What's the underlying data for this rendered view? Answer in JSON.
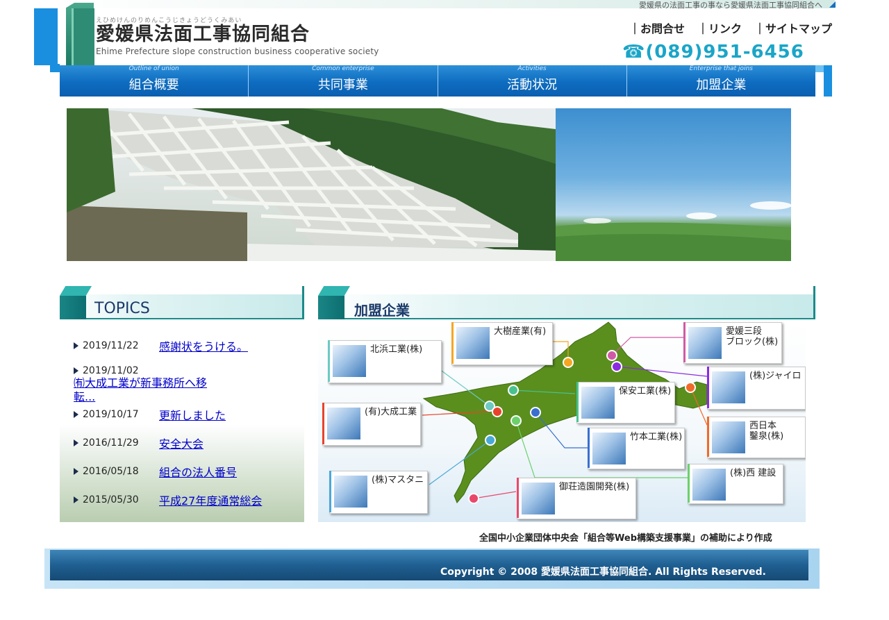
{
  "header": {
    "tagline": "愛媛県の法面工事の事なら愛媛県法面工事協同組合へ",
    "logo_ruby": "えひめけんのりめんこうじきょうどうくみあい",
    "logo_main": "愛媛県法面工事協同組合",
    "logo_en": "Ehime Prefecture slope construction business cooperative society",
    "links": [
      "｜お問合せ",
      "｜リンク",
      "｜サイトマップ"
    ],
    "phone": "☎(089)951-6456"
  },
  "nav": [
    {
      "en": "Outline of union",
      "jp": "組合概要"
    },
    {
      "en": "Common enterprise",
      "jp": "共同事業"
    },
    {
      "en": "Activities",
      "jp": "活動状況"
    },
    {
      "en": "Enterprise that joins",
      "jp": "加盟企業"
    }
  ],
  "topics": {
    "title": "TOPICS",
    "items": [
      {
        "date": "2019/11/22",
        "text": "感謝状をうける。"
      },
      {
        "date": "2019/11/02",
        "text": "㈲大成工業が新事務所へ移転..."
      },
      {
        "date": "2019/10/17",
        "text": "更新しました"
      },
      {
        "date": "2016/11/29",
        "text": "安全大会"
      },
      {
        "date": "2016/05/18",
        "text": "組合の法人番号"
      },
      {
        "date": "2015/05/30",
        "text": "平成27年度通常総会"
      }
    ]
  },
  "members": {
    "title": "加盟企業",
    "companies": [
      {
        "name": "北浜工業(株)",
        "color": "#6cc9c4"
      },
      {
        "name": "大樹産業(有)",
        "color": "#f5a623"
      },
      {
        "name": "愛媛三段\nブロック(株)",
        "color": "#d05aa5"
      },
      {
        "name": "(株)ジャイロ",
        "color": "#8a2be2"
      },
      {
        "name": "保安工業(株)",
        "color": "#4ac28f"
      },
      {
        "name": "(有)大成工業",
        "color": "#e8432a"
      },
      {
        "name": "西日本\n鑿泉(株)",
        "color": "#f06a2a"
      },
      {
        "name": "竹本工業(株)",
        "color": "#3a6fd0"
      },
      {
        "name": "(株)マスタニ",
        "color": "#4aa8d8"
      },
      {
        "name": "御荘造園開発(株)",
        "color": "#e8486a"
      },
      {
        "name": "(株)西 建設",
        "color": "#6cd06c"
      }
    ]
  },
  "footer": {
    "credit": "全国中小企業団体中央会「組合等Web構築支援事業」の補助により作成",
    "copyright": "Copyright © 2008 愛媛県法面工事協同組合. All Rights Reserved."
  }
}
